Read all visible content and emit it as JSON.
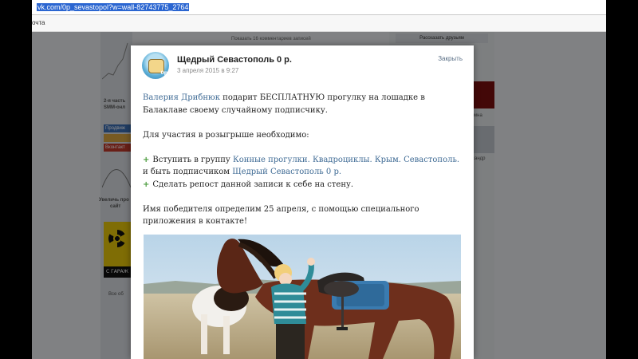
{
  "browser": {
    "url": "vk.com/0p_sevastopol?w=wall-82743775_2764",
    "bookmark": "очта"
  },
  "background": {
    "top_label": "Показать 16 комментариев записей",
    "right_button": "Рассказать друзьям",
    "left_snippets": [
      "2-я часть",
      "SMM-онл",
      "Продвиж",
      "Вконтакт",
      "Увеличь про",
      "сайт",
      "Все об"
    ],
    "right_snippets": [
      "мна",
      "ександр"
    ],
    "radiation_label": "С ГАРАЖ"
  },
  "post": {
    "group_name": "Щедрый Севастополь 0 р.",
    "date": "3 апреля 2015 в 9:27",
    "close_label": "Закрыть",
    "intro_link": "Валерия Дрибнюк",
    "intro_text": " подарит БЕСПЛАТНУЮ прогулку на лошадке в Балаклаве своему случайному подписчику.",
    "conditions_title": "Для участия в розыгрыше необходимо:",
    "step1_prefix": "Вступить в группу ",
    "step1_link": "Конные прогулки. Квадроциклы. Крым. Севастополь.",
    "step1_middle": " и быть подписчиком ",
    "step1_link2": "Щедрый Севастополь 0 р.",
    "step2_text": "Сделать репост данной записи к себе на стену.",
    "winner_text": "Имя победителя определим 25 апреля, с помощью специального приложения в контакте!",
    "plus_symbol": "+"
  },
  "colors": {
    "link": "#3e6a94",
    "plus": "#4a9b3c",
    "selection": "#2b66d1"
  }
}
